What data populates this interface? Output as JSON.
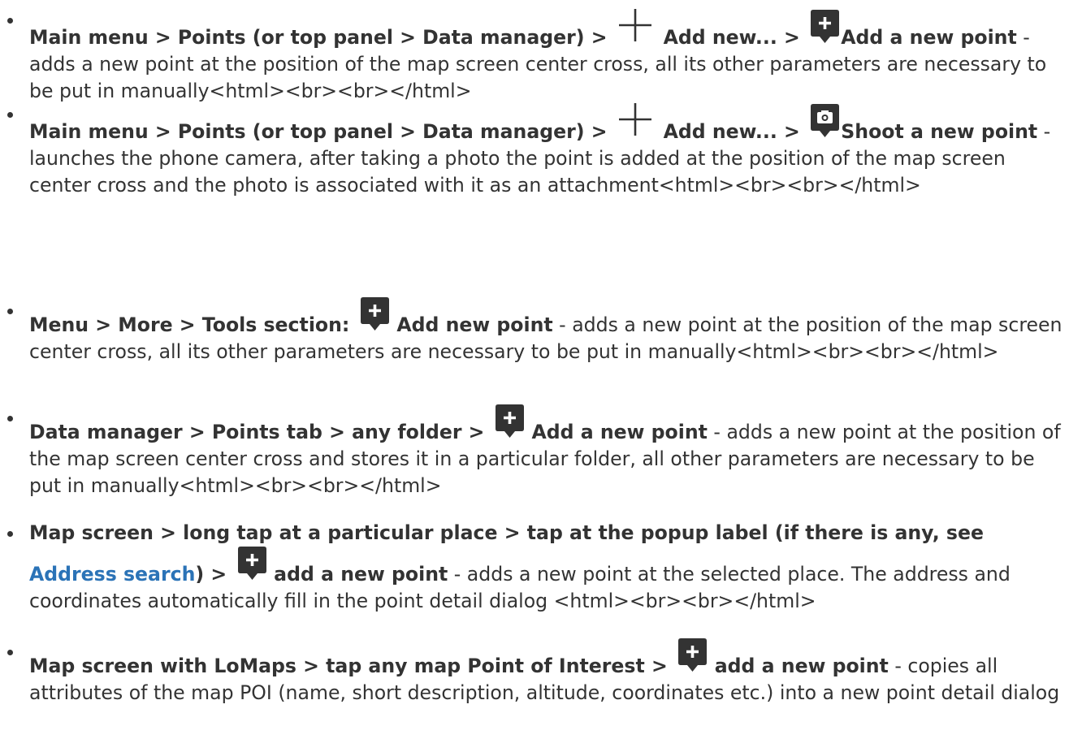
{
  "items": [
    {
      "p1": "Main menu > Points (or top panel > Data manager) >",
      "p2": "Add new... >",
      "p3": "Add a new point",
      "desc": " - adds a new point at the position of the map screen center cross, all its other parameters are necessary to be put in manually<html><br><br></html>"
    },
    {
      "p1": "Main menu > Points (or top panel > Data manager) >",
      "p2": "Add new... >",
      "p3": "Shoot a new point",
      "desc": " - launches the phone camera, after taking a photo the point is added at the position of the map screen center cross and the photo is associated with it as an attachment<html><br><br></html>"
    },
    {
      "p1": "Menu > More > Tools section:",
      "p2": "Add new point",
      "desc": " - adds a new point at the position of the map screen center cross, all its other parameters are necessary to be put in manually<html><br><br></html>"
    },
    {
      "p1": "Data manager > Points tab > any folder >",
      "p2": "Add a new point",
      "desc": " - adds a new point at the position of the map screen center cross and stores it in a particular folder, all other parameters are necessary to be put in manually<html><br><br></html>"
    },
    {
      "p1": "Map screen > long tap at a particular place > tap at the popup label (if there is any, see",
      "link": "Address search",
      "p2": ") >",
      "p3": "add a new point",
      "desc": " - adds a new point at the selected place. The address and coordinates automatically fill in the point detail dialog <html><br><br></html>"
    },
    {
      "p1": "Map screen with LoMaps > tap any map Point of Interest >",
      "p2": "add a new point",
      "desc": " - copies all attributes of the map POI (name, short description, altitude, coordinates etc.) into a new point detail dialog"
    }
  ],
  "icons": {
    "plus": "plus-icon",
    "add_point": "add-point-icon",
    "camera_point": "camera-point-icon"
  },
  "colors": {
    "text": "#333333",
    "link": "#2b73b7",
    "icon": "#333333"
  }
}
